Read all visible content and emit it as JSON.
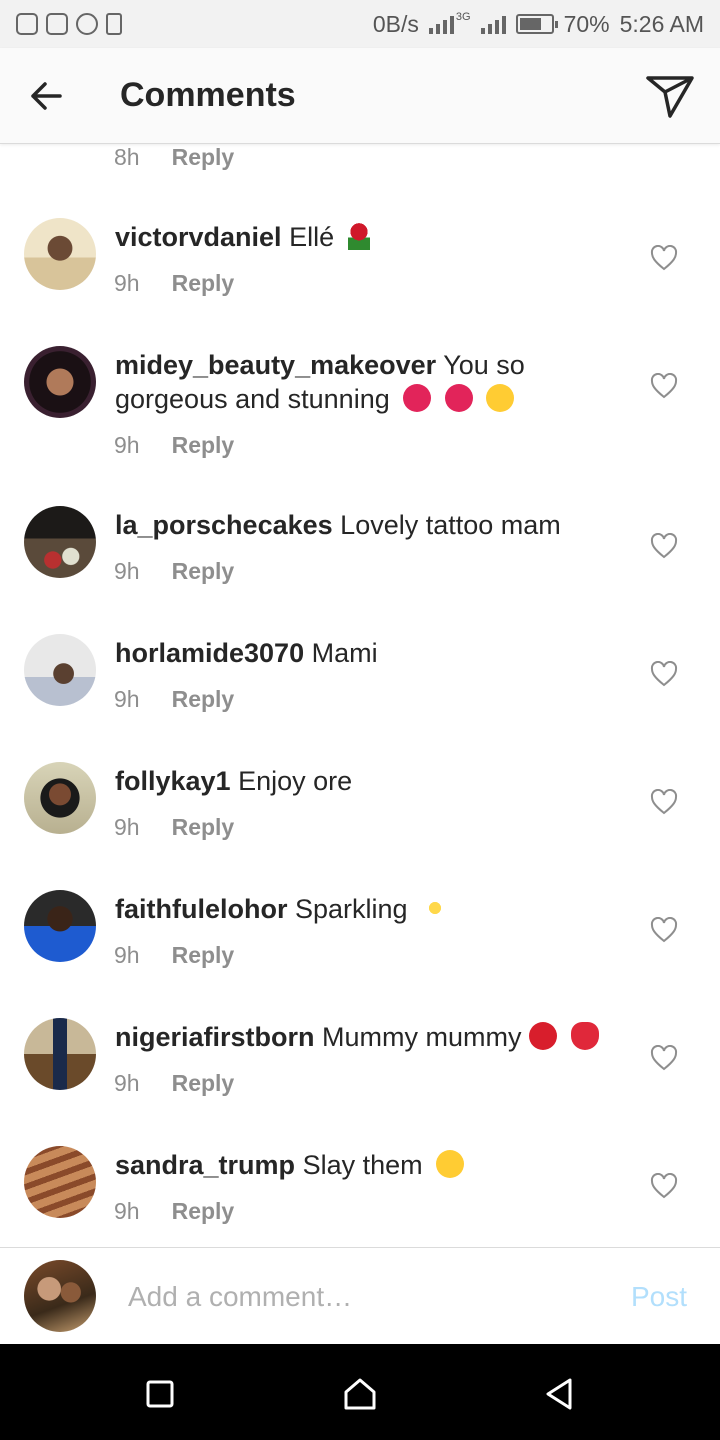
{
  "status_bar": {
    "net_speed": "0B/s",
    "network_type": "3G",
    "battery_percent": "70%",
    "battery_level": 0.7,
    "time": "5:26 AM"
  },
  "header": {
    "title": "Comments"
  },
  "partial_comment": {
    "time": "8h",
    "reply_label": "Reply"
  },
  "comments": [
    {
      "username": "victorvdaniel",
      "text": "Ellé",
      "emoji": "rose",
      "time": "9h",
      "reply_label": "Reply"
    },
    {
      "username": "midey_beauty_makeover",
      "text": "You so gorgeous and stunning",
      "emoji": "two-hearts two-hearts kissing-face",
      "time": "9h",
      "reply_label": "Reply"
    },
    {
      "username": "la_porschecakes",
      "text": "Lovely tattoo mam",
      "emoji": "",
      "time": "9h",
      "reply_label": "Reply"
    },
    {
      "username": "horlamide3070",
      "text": "Mami",
      "emoji": "",
      "time": "9h",
      "reply_label": "Reply"
    },
    {
      "username": "follykay1",
      "text": "Enjoy ore",
      "emoji": "",
      "time": "9h",
      "reply_label": "Reply"
    },
    {
      "username": "faithfulelohor",
      "text": "Sparkling",
      "emoji": "sparkles",
      "time": "9h",
      "reply_label": "Reply"
    },
    {
      "username": "nigeriafirstborn",
      "text": "Mummy mummy",
      "emoji": "red-heart kiss-mark",
      "time": "9h",
      "reply_label": "Reply"
    },
    {
      "username": "sandra_trump",
      "text": "Slay them",
      "emoji": "heart-eyes",
      "time": "9h",
      "reply_label": "Reply"
    }
  ],
  "composer": {
    "placeholder": "Add a comment…",
    "post_label": "Post"
  },
  "colors": {
    "post_disabled": "#b2dffc",
    "secondary_text": "#8e8e8e",
    "primary_text": "#262626"
  }
}
